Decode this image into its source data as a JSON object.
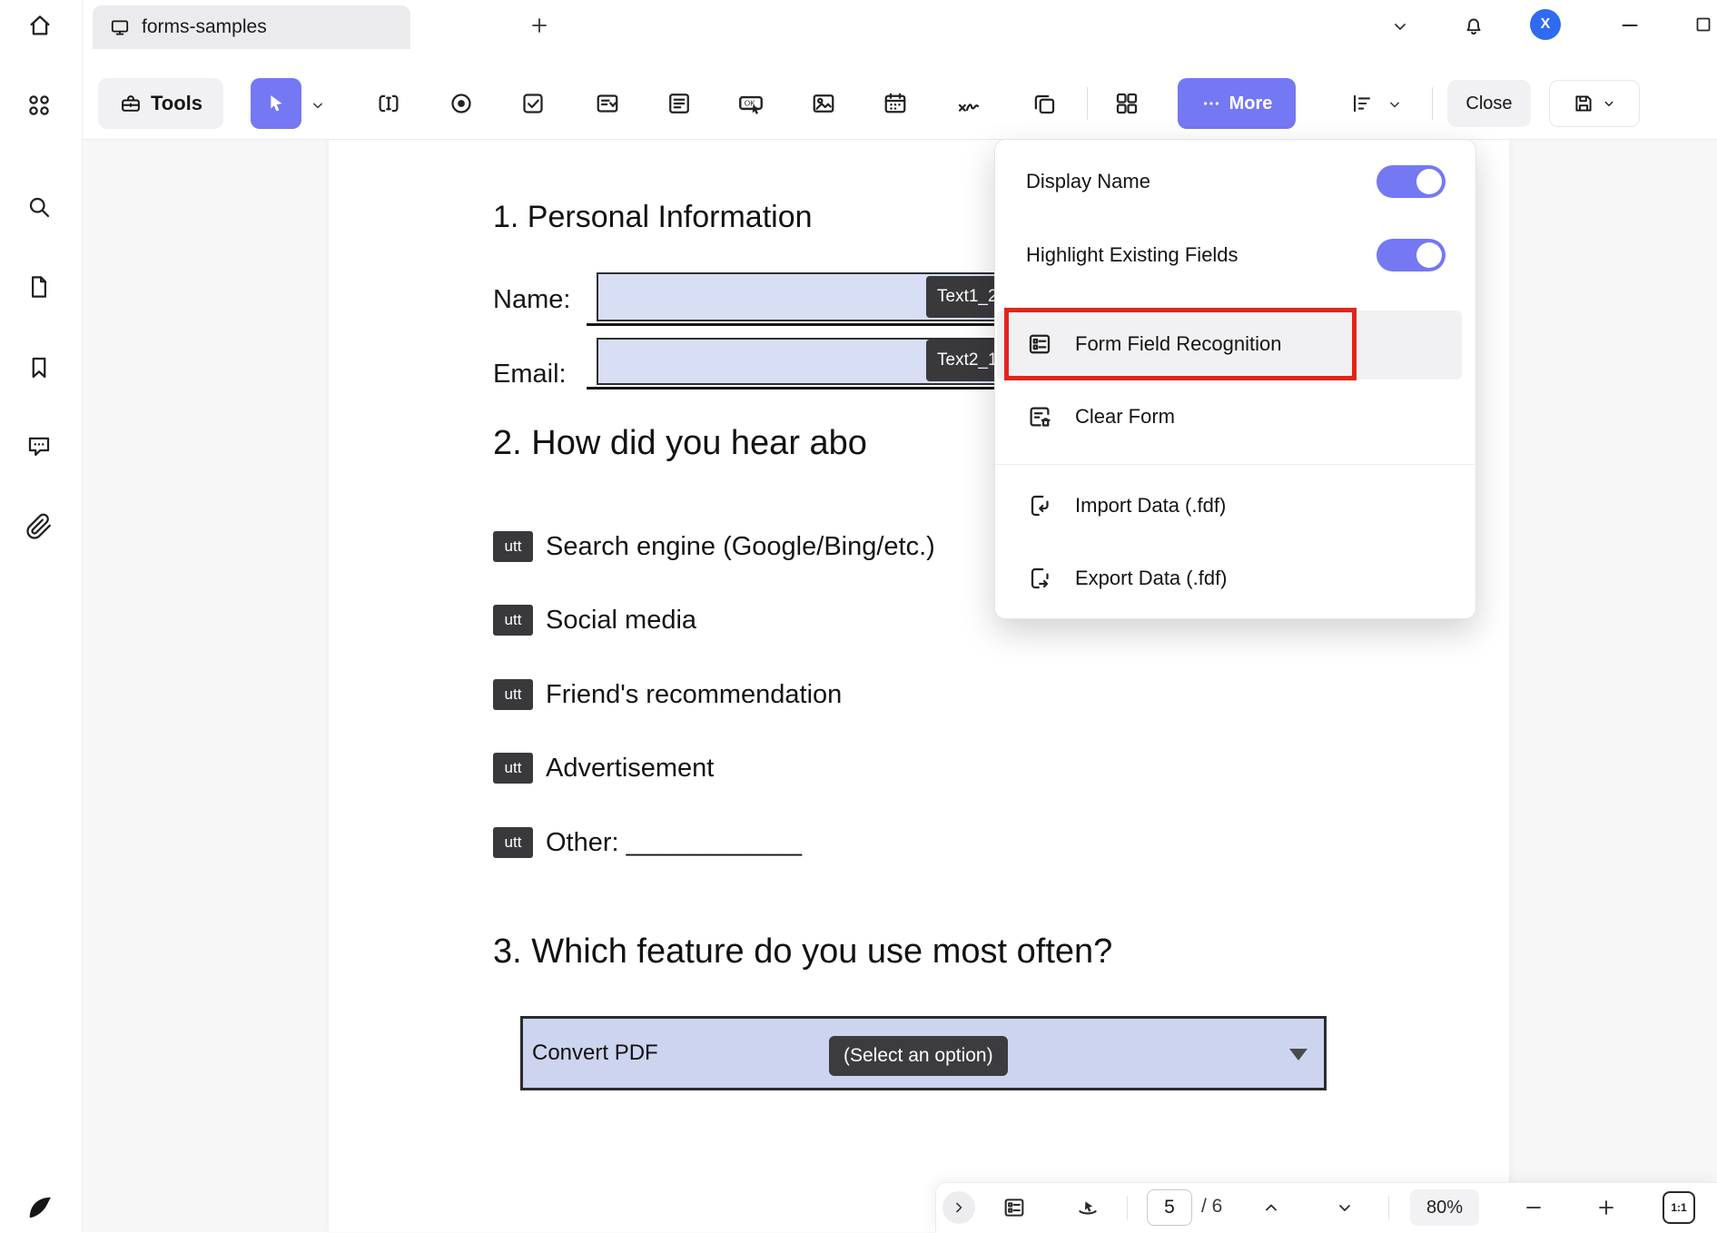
{
  "colors": {
    "accent": "#7478f3",
    "annotation_red": "#e1251b",
    "field_fill": "#d8def4",
    "badge_dark": "#39393b"
  },
  "titlebar": {
    "tab_title": "forms-samples",
    "avatar_initial": "X"
  },
  "toolbar": {
    "tools_label": "Tools",
    "more_label": "More",
    "close_label": "Close"
  },
  "more_menu": {
    "display_name_label": "Display Name",
    "display_name_on": true,
    "highlight_fields_label": "Highlight Existing Fields",
    "highlight_fields_on": true,
    "items": [
      {
        "label": "Form Field Recognition",
        "annotated": true
      },
      {
        "label": "Clear Form",
        "annotated": false
      },
      {
        "label": "Import Data (.fdf)",
        "annotated": false
      },
      {
        "label": "Export Data (.fdf)",
        "annotated": false
      }
    ]
  },
  "document": {
    "section1_heading": "1. Personal Information",
    "name_label": "Name:",
    "name_field_name": "Text1_2",
    "email_label": "Email:",
    "email_field_name": "Text2_1",
    "section2_heading": "2. How did you hear abo",
    "checkboxes": [
      {
        "badge": "utt",
        "label": "Search engine (Google/Bing/etc.)"
      },
      {
        "badge": "utt",
        "label": "Social media"
      },
      {
        "badge": "utt",
        "label": "Friend's recommendation"
      },
      {
        "badge": "utt",
        "label": "Advertisement"
      },
      {
        "badge": "utt",
        "label": "Other: ____________"
      }
    ],
    "section3_heading": "3. Which feature do you use most often?",
    "dropdown_value": "Convert PDF",
    "dropdown_badge": "(Select an option)"
  },
  "statusbar": {
    "page_number": "5",
    "page_total": "/ 6",
    "zoom_level": "80%",
    "ratio_label": "1:1"
  },
  "icons": {
    "tab_icon": "monitor",
    "select_tool": "cursor-arrow",
    "push_button_glyph": "OK",
    "more_icon": "ellipsis-dots",
    "ai_assistant": "blue-swirl",
    "window_controls": [
      "minimize",
      "maximize",
      "close"
    ]
  }
}
